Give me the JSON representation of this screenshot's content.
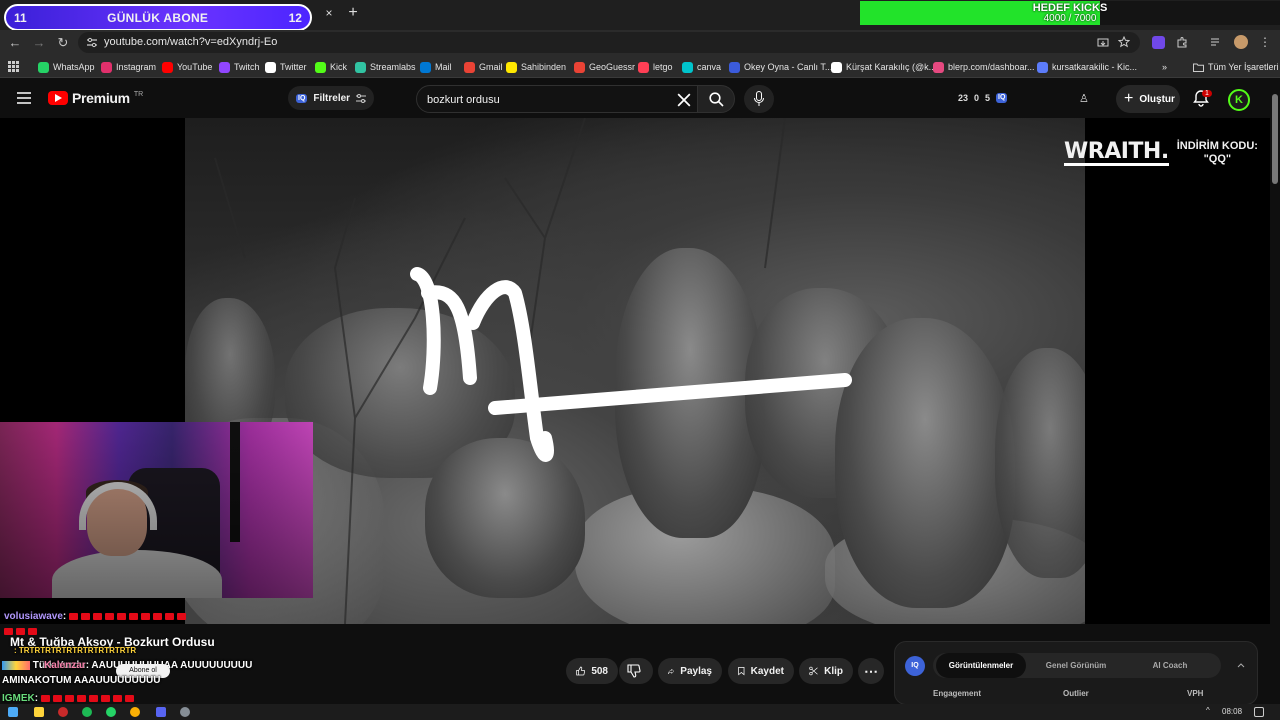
{
  "overlay": {
    "sub_goal_label": "GÜNLÜK ABONE",
    "sub_current": "11",
    "sub_target": "12",
    "kicks_title": "HEDEF KICKS",
    "kicks_progress": "4000 / 7000",
    "kicks_fraction": 0.571
  },
  "tabs": {
    "close": "×",
    "new": "+"
  },
  "browser": {
    "url": "youtube.com/watch?v=edXyndrj-Eo",
    "back": "←",
    "forward": "→",
    "reload": "↻"
  },
  "bookmarks": [
    {
      "label": "WhatsApp",
      "color": "#25d366"
    },
    {
      "label": "Instagram",
      "color": "#e1306c"
    },
    {
      "label": "YouTube",
      "color": "#ff0000"
    },
    {
      "label": "Twitch",
      "color": "#9146ff"
    },
    {
      "label": "Twitter",
      "color": "#ffffff"
    },
    {
      "label": "Kick",
      "color": "#53fc18"
    },
    {
      "label": "Streamlabs",
      "color": "#31c3a2"
    },
    {
      "label": "Mail",
      "color": "#0078d4"
    },
    {
      "label": "Gmail",
      "color": "#ea4335"
    },
    {
      "label": "Sahibinden",
      "color": "#ffe800"
    },
    {
      "label": "GeoGuessr",
      "color": "#ea4335"
    },
    {
      "label": "letgo",
      "color": "#ff3f55"
    },
    {
      "label": "canva",
      "color": "#00c4cc"
    },
    {
      "label": "Okey Oyna - Canlı T...",
      "color": "#3b5bdb"
    },
    {
      "label": "Kürşat Karakılıç (@k...",
      "color": "#ffffff"
    },
    {
      "label": "blerp.com/dashboar...",
      "color": "#e64980"
    },
    {
      "label": "kursatkarakilic - Kic...",
      "color": "#5c7cfa"
    }
  ],
  "bookmarks_more": "»",
  "bookmarks_all": "Tüm Yer İşaretleri",
  "youtube": {
    "logo": "Premium",
    "region": "TR",
    "filters_label": "Filtreler",
    "search_query": "bozkurt ordusu",
    "counters": {
      "a": "23",
      "b": "0",
      "c": "5"
    },
    "create_label": "Oluştur",
    "notif_count": "1",
    "avatar_letter": "K"
  },
  "video": {
    "sponsor_brand": "WRAITH.",
    "sponsor_line1": "İNDİRİM KODU:",
    "sponsor_line2": "\"QQ\""
  },
  "watch": {
    "title": "Mt & Tuğba Aksoy - Bozkurt Ordusu",
    "subscribe_label": "Abone ol",
    "likes": "508",
    "share": "Paylaş",
    "save": "Kaydet",
    "clip": "Klip",
    "more": "⋯"
  },
  "chat": [
    {
      "user": "volusiawave",
      "msg": ":",
      "flags": 10,
      "user_color": "#b197fc"
    },
    {
      "user": "",
      "msg": "",
      "flags": 3,
      "user_color": "#ffffff"
    },
    {
      "user": "",
      "msg": ": TRTRTRTRTRTRTRTRTRTRTR",
      "flags": 0,
      "user_color": "#ffd43b"
    },
    {
      "user": "Türk Yurdu",
      "msg": "",
      "flags": 0,
      "user_color": "#ffffff"
    },
    {
      "user": "Kalenzar",
      "msg": ": AAUUUUUUUUAA AUUUUUUUUU",
      "flags": 0,
      "user_color": "#f783ac"
    },
    {
      "user": "",
      "msg": "AMINAKOTUM AAAUUUUUUUUU",
      "flags": 0,
      "user_color": "#ffffff"
    },
    {
      "user": "IGMEK",
      "msg": ":",
      "flags": 8,
      "user_color": "#69db7c"
    }
  ],
  "iq_panel": {
    "logo": "IQ",
    "tabs": [
      "Görüntülenmeler",
      "Genel Görünüm",
      "AI Coach"
    ],
    "active_tab": 0,
    "columns": [
      "Engagement",
      "Outlier",
      "VPH"
    ]
  },
  "taskbar": {
    "time": "08:08"
  }
}
